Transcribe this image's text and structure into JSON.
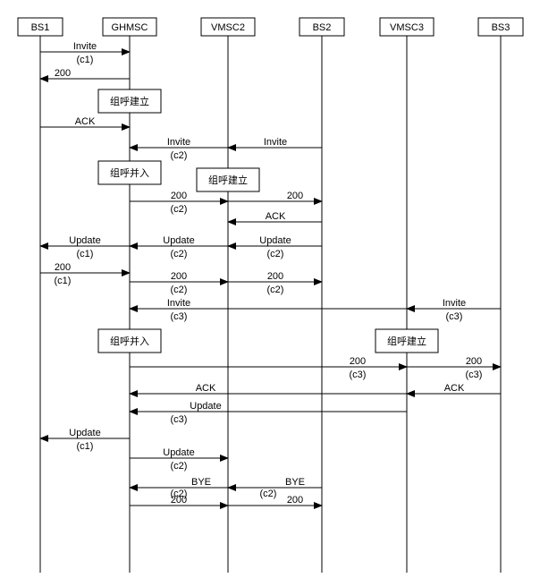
{
  "participants": [
    "BS1",
    "GHMSC",
    "VMSC2",
    "BS2",
    "VMSC3",
    "BS3"
  ],
  "box_labels": {
    "establish": "组呼建立",
    "join": "组呼并入"
  },
  "messages": {
    "invite": "Invite",
    "ack": "ACK",
    "update": "Update",
    "bye": "BYE",
    "ok200": "200"
  },
  "calls": {
    "c1": "(c1)",
    "c2": "(c2)",
    "c3": "(c3)"
  }
}
